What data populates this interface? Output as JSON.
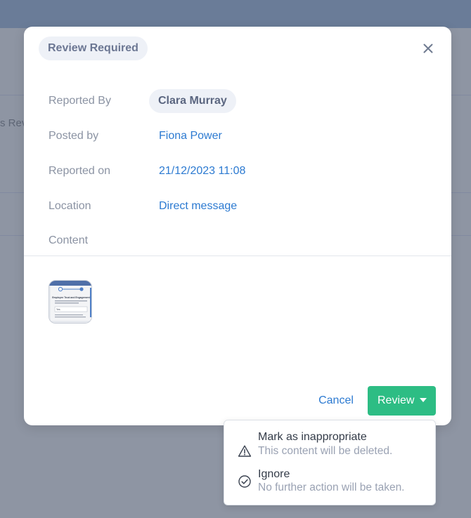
{
  "background": {
    "partial_text": "s Rev"
  },
  "modal": {
    "badge": "Review Required",
    "close_icon": "close-icon",
    "fields": {
      "reported_by": {
        "label": "Reported By",
        "value": "Clara Murray"
      },
      "posted_by": {
        "label": "Posted by",
        "value": "Fiona Power"
      },
      "reported_on": {
        "label": "Reported on",
        "value": "21/12/2023 11:08"
      },
      "location": {
        "label": "Location",
        "value": "Direct message"
      },
      "content": {
        "label": "Content"
      }
    },
    "attachment": {
      "heading": "Employee Trust and Engagement",
      "field_value": "Yes"
    },
    "actions": {
      "cancel": "Cancel",
      "review": "Review"
    }
  },
  "review_menu": {
    "items": [
      {
        "icon": "warning-icon",
        "title": "Mark as inappropriate",
        "description": "This content will be deleted."
      },
      {
        "icon": "check-circle-icon",
        "title": "Ignore",
        "description": "No further action will be taken."
      }
    ]
  },
  "colors": {
    "accent_link": "#2c7ad1",
    "review_button": "#2dbd84",
    "backdrop": "#8e95a3"
  }
}
